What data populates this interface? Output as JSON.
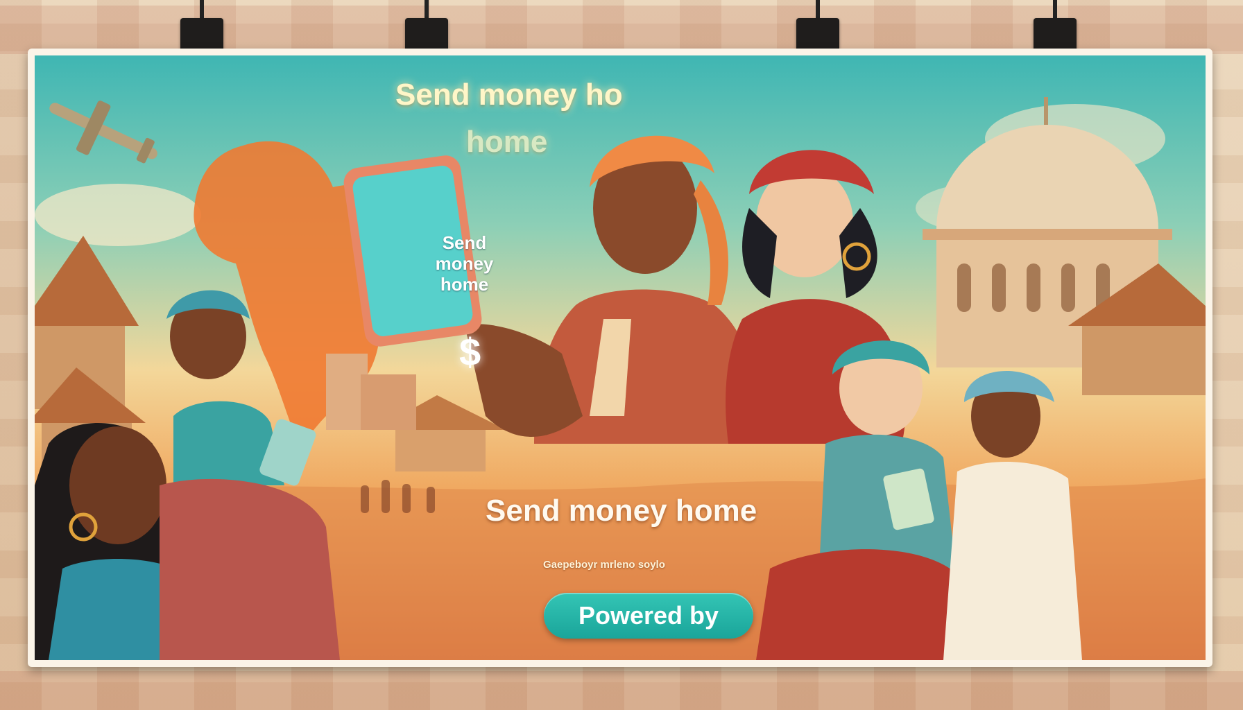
{
  "billboard": {
    "headline_line1": "Send money ho",
    "headline_line2": "home",
    "phone_text": "Send money home",
    "phone_symbol": "$",
    "main_title": "Send money home",
    "tagline": "Gaepeboyr mrleno soylo",
    "cta_label": "Powered by"
  },
  "colors": {
    "cta": "#1fae9f",
    "africa_map": "#f07a32",
    "sky": "#3fb6b3",
    "desert": "#e0884a"
  }
}
